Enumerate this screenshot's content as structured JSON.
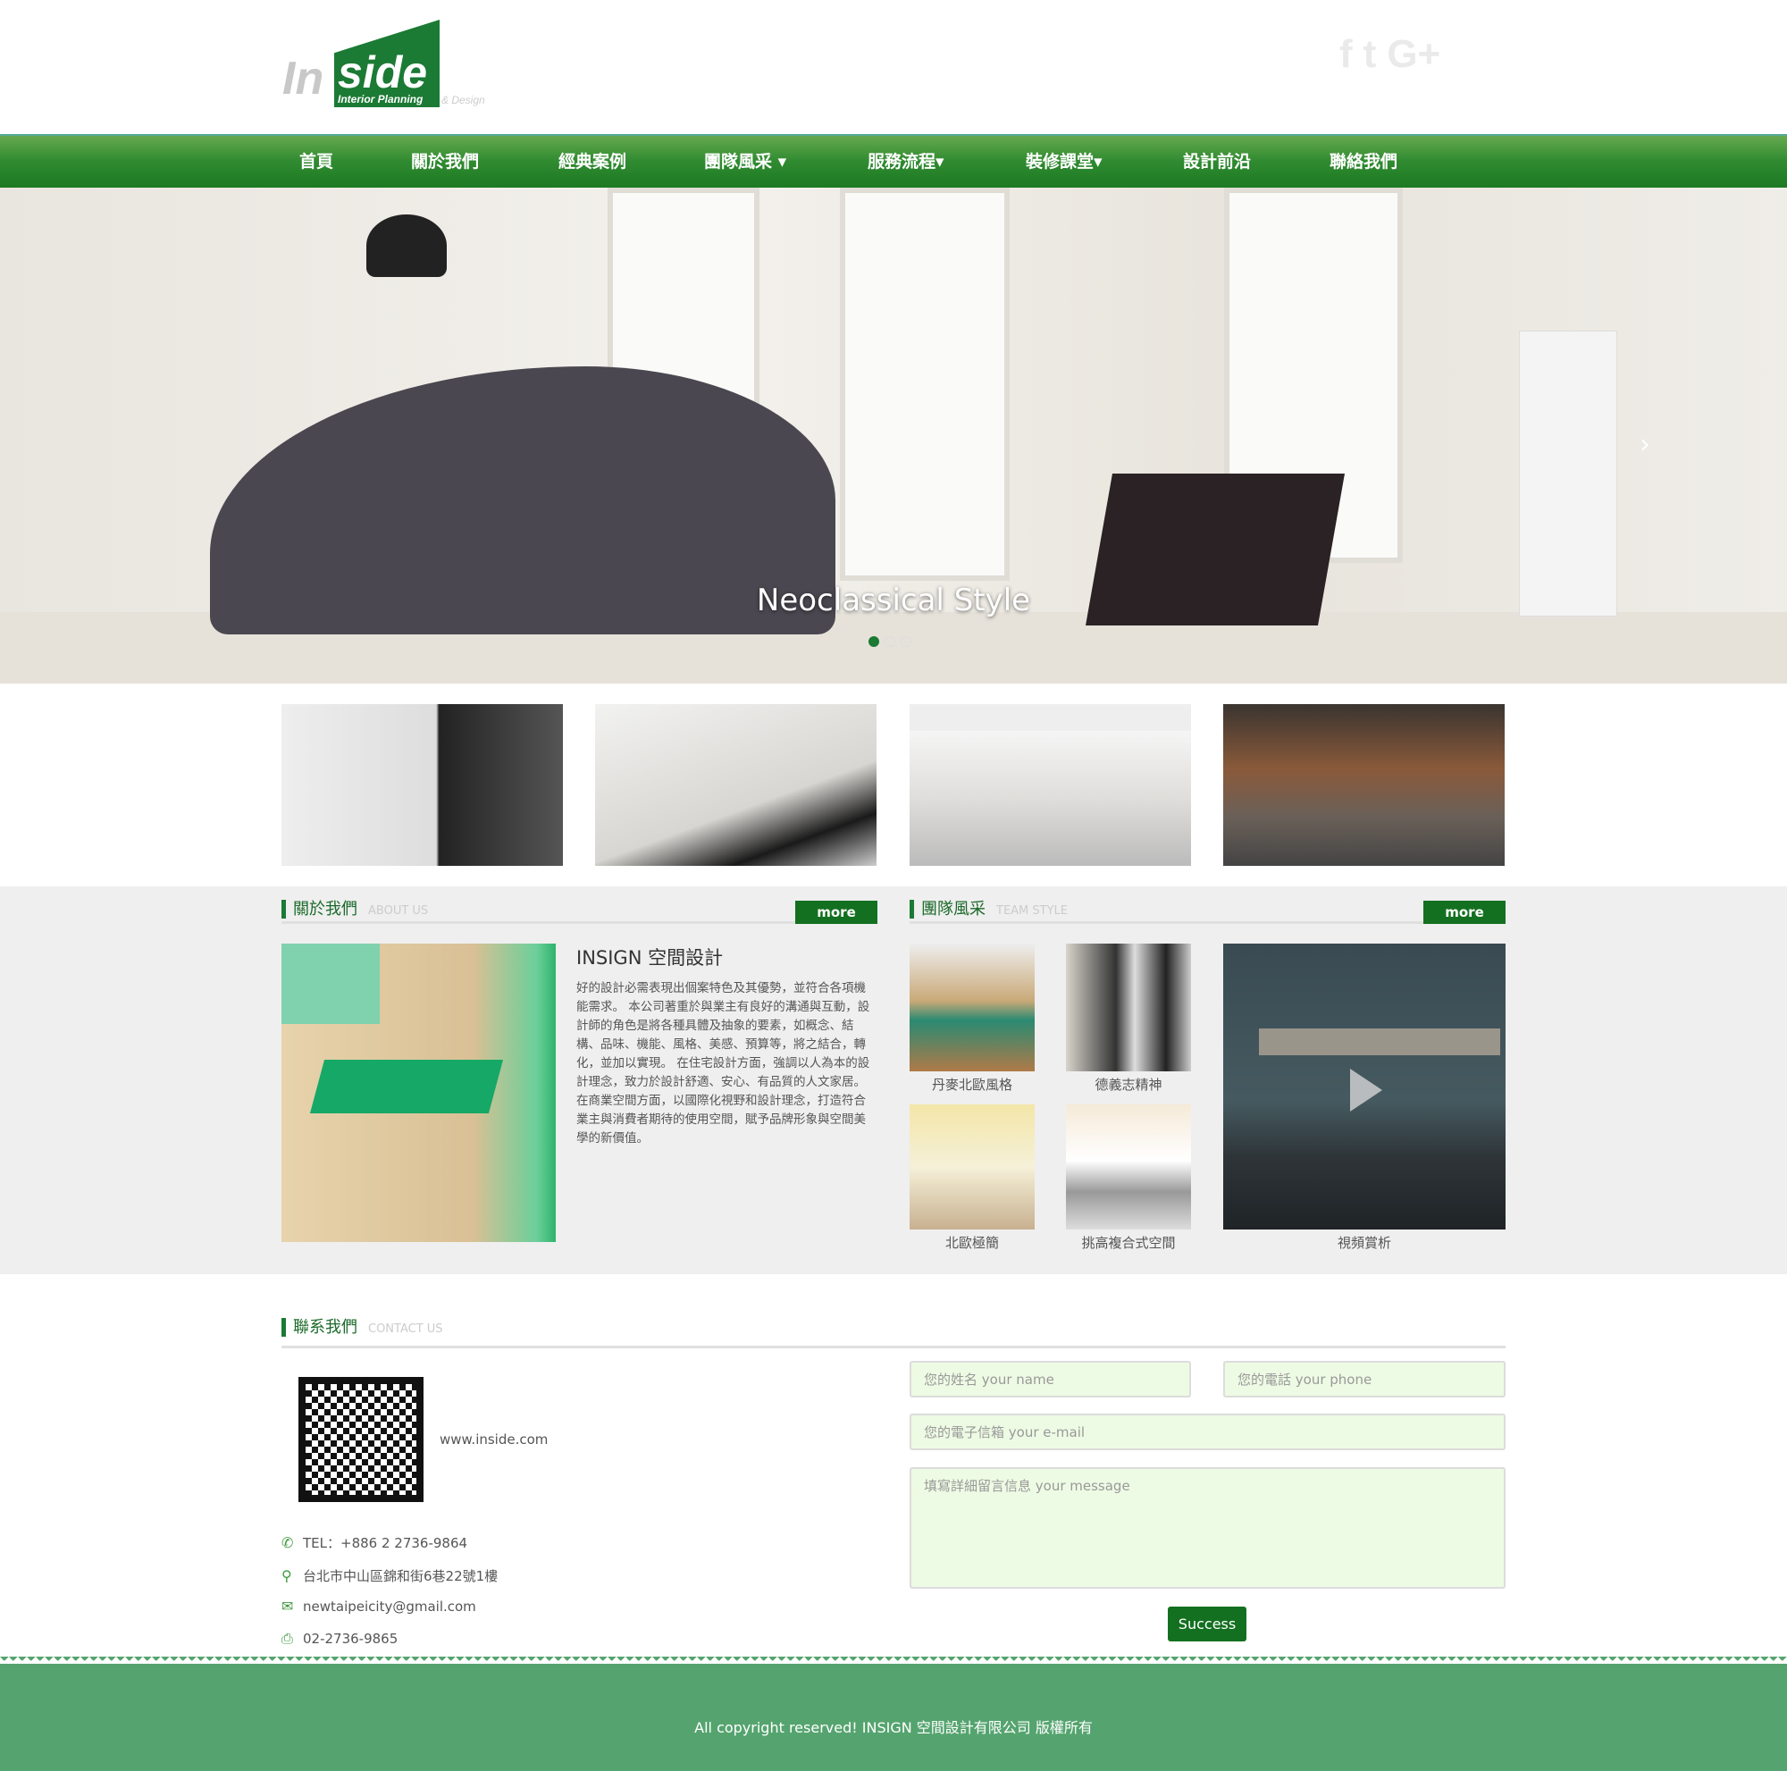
{
  "logo": {
    "text_in": "In",
    "text_side": "side",
    "sub": "Interior Planning",
    "sub2": "& Design"
  },
  "social": [
    {
      "icon": "facebook-icon",
      "glyph": "f"
    },
    {
      "icon": "twitter-icon",
      "glyph": "t"
    },
    {
      "icon": "google-plus-icon",
      "glyph": "G+"
    }
  ],
  "nav": [
    "首頁",
    "關於我們",
    "經典案例",
    "團隊風采 ▾",
    "服務流程▾",
    "裝修課堂▾",
    "設計前沿",
    "聯絡我們"
  ],
  "hero": {
    "caption": "Neoclassical Style",
    "slides": 3,
    "active": 0
  },
  "about": {
    "title": "關於我們",
    "en": "ABOUT US",
    "more": "more",
    "heading": "INSIGN 空間設計",
    "body": "好的設計必需表現出個案特色及其優勢，並符合各項機能需求。 本公司著重於與業主有良好的溝通與互動，設計師的角色是將各種具體及抽象的要素，如概念、結構、品味、機能、風格、美感、預算等，將之結合，轉化，並加以實現。 在住宅設計方面，強調以人為本的設計理念，致力於設計舒適、安心、有品質的人文家居。 在商業空間方面，以國際化視野和設計理念，打造符合業主與消費者期待的使用空間，賦予品牌形象與空間美學的新價值。"
  },
  "team": {
    "title": "團隊風采",
    "en": "TEAM STYLE",
    "more": "more",
    "items": [
      "丹麥北歐風格",
      "德義志精神",
      "北歐極簡",
      "挑高複合式空間"
    ],
    "video": "視頻賞析"
  },
  "contact": {
    "title": "聯系我們",
    "en": "CONTACT US",
    "website": "www.inside.com",
    "tel": "TEL：+886 2 2736-9864",
    "address": "台北市中山區錦和街6巷22號1樓",
    "email": "newtaipeicity@gmail.com",
    "fax": "02-2736-9865",
    "form": {
      "name": "您的姓名 your name",
      "phone": "您的電話 your phone",
      "email": "您的電子信箱 your e-mail",
      "message": "填寫詳細留言信息 your message",
      "submit": "Success"
    }
  },
  "footer": "All copyright reserved! INSIGN 空間設計有限公司 版權所有",
  "colors": {
    "brand": "#1b7a34",
    "footer": "#55a46f",
    "input": "#eefbe4"
  }
}
